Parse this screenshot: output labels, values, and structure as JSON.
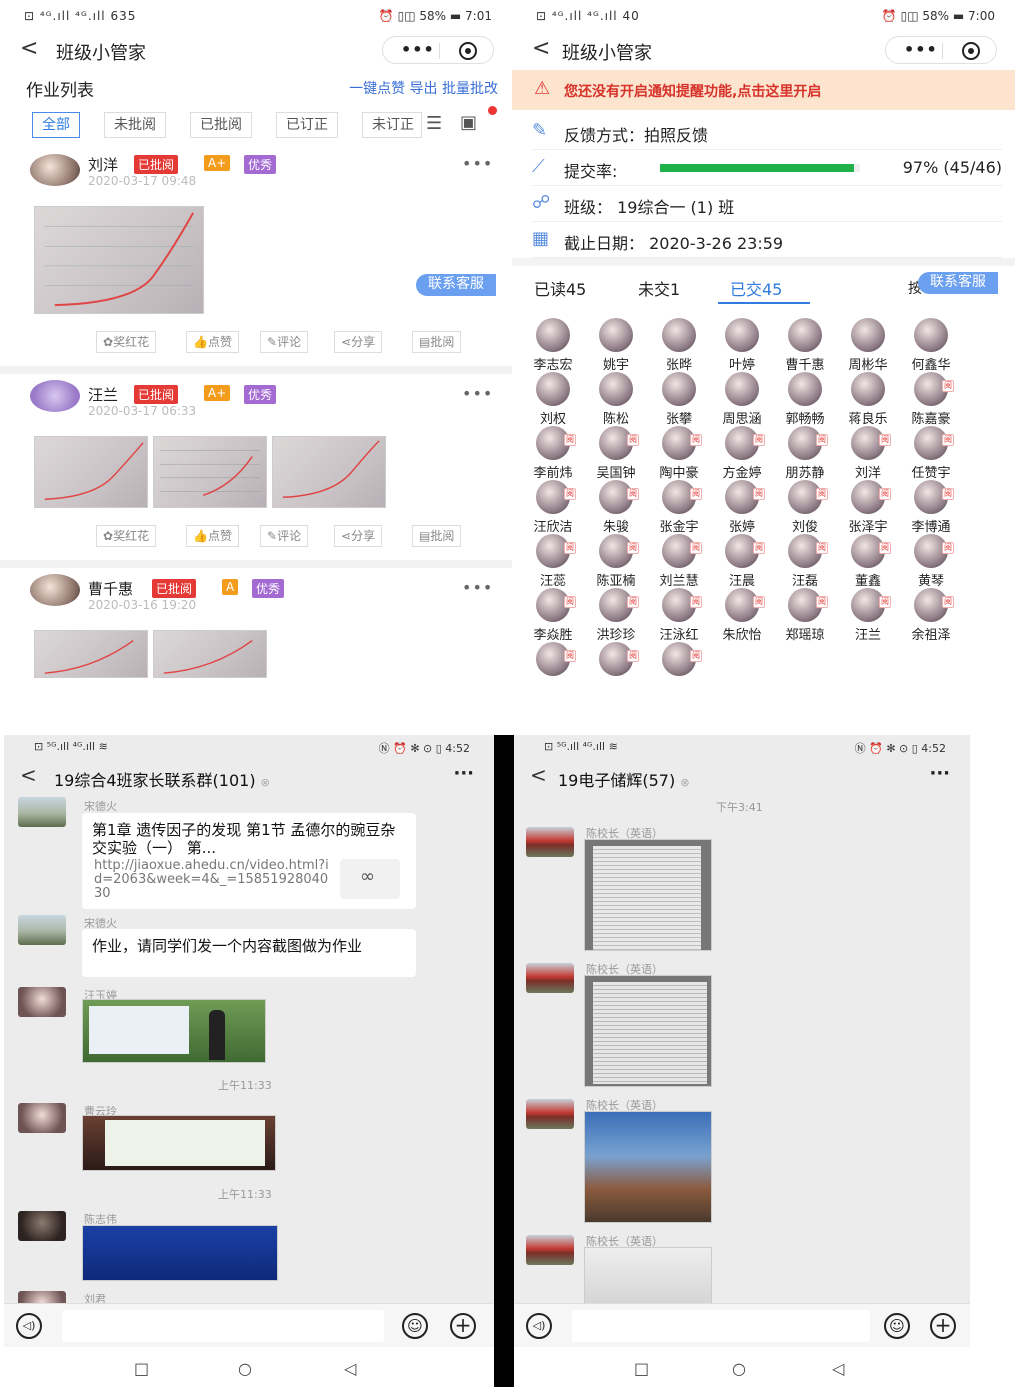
{
  "p1": {
    "status_left": "⊡ ⁴ᴳ.ıll ⁴ᴳ.ıll 635",
    "status_right": "⏰ ▯◫ 58% ▬ 7:01",
    "nav_title": "班级小管家",
    "list_title": "作业列表",
    "actions": "一键点赞  导出  批量批改",
    "filters": [
      "全部",
      "未批阅",
      "已批阅",
      "已订正",
      "未订正"
    ],
    "kefu": "联系客服",
    "action_buttons": [
      "奖红花",
      "点赞",
      "评论",
      "分享",
      "批阅"
    ],
    "posts": [
      {
        "name": "刘洋",
        "tag1": "已批阅",
        "tag2": "A+",
        "tag3": "优秀",
        "date": "2020-03-17 09:48"
      },
      {
        "name": "汪兰",
        "tag1": "已批阅",
        "tag2": "A+",
        "tag3": "优秀",
        "date": "2020-03-17 06:33"
      },
      {
        "name": "曹千惠",
        "tag1": "已批阅",
        "tag2": "A",
        "tag3": "优秀",
        "date": "2020-03-16 19:20"
      }
    ]
  },
  "p2": {
    "status_left": "⊡ ⁴ᴳ.ıll ⁴ᴳ.ıll 40",
    "status_right": "⏰ ▯◫ 58% ▬ 7:00",
    "nav_title": "班级小管家",
    "warning": "您还没有开启通知提醒功能,点击这里开启",
    "feedback": "反馈方式：拍照反馈",
    "rate_label": "提交率:",
    "rate_value": 0.97,
    "rate_text": "97% (45/46)",
    "class_label": "班级：  19综合一  (1)  班",
    "deadline": "截止日期：  2020-3-26 23:59",
    "tabs": [
      "已读45",
      "未交1",
      "已交45"
    ],
    "tab_extra": "按",
    "kefu": "联系客服",
    "read_mark": "阅",
    "students": [
      "李志宏",
      "姚宇",
      "张晔",
      "叶婷",
      "曹千惠",
      "周彬华",
      "何鑫华",
      "刘权",
      "陈松",
      "张攀",
      "周思涵",
      "郭畅畅",
      "蒋良乐",
      "陈嘉豪",
      "李前炜",
      "吴国钟",
      "陶中豪",
      "方金婷",
      "朋苏静",
      "刘洋",
      "任赞宇",
      "汪欣洁",
      "朱骏",
      "张金宇",
      "张婷",
      "刘俊",
      "张泽宇",
      "李博通",
      "汪蕊",
      "陈亚楠",
      "刘兰慧",
      "汪晨",
      "汪磊",
      "董鑫",
      "黄琴",
      "李焱胜",
      "洪珍珍",
      "汪泳红",
      "朱欣怡",
      "郑瑶琼",
      "汪兰",
      "余祖泽",
      "",
      "",
      ""
    ]
  },
  "p3": {
    "status_left": "⊡ ⁵ᴳ.ıll ⁴ᴳ.ıll ≋",
    "status_right": "Ⓝ ⏰ ✻ ⊙ ▯ 4:52",
    "title": "19综合4班家长联系群(101)",
    "mute_icon": "⊗",
    "messages": {
      "m1_sender": "宋德火",
      "m1_text": "第1章 遗传因子的发现 第1节 孟德尔的豌豆杂交实验（一） 第...",
      "m1_link": "http://jiaoxue.ahedu.cn/video.html?id=2063&week=4&_=1585192804030",
      "m2_sender": "宋德火",
      "m2_text": "作业，请同学们发一个内容截图做为作业",
      "m3_sender": "汪玉婷",
      "t1": "上午11:33",
      "m4_sender": "曹云玲",
      "t2": "上午11:33",
      "m5_sender": "陈志伟",
      "m6_sender": "刘君"
    }
  },
  "p4": {
    "status_left": "⊡ ⁵ᴳ.ıll ⁴ᴳ.ıll ≋",
    "status_right": "Ⓝ ⏰ ✻ ⊙ ▯ 4:52",
    "title": "19电子储辉(57)",
    "mute_icon": "⊗",
    "time": "下午3:41",
    "sender": "陈校长（英语）"
  },
  "chat_ui": {
    "voice": "◁)",
    "emoji": "☺",
    "plus": "+",
    "nav": [
      "□",
      "○",
      "◁"
    ]
  },
  "colors": {
    "accent": "#2f7be0",
    "warn": "#d6322a",
    "progress": "#21b14b",
    "tag_red": "#e53935",
    "tag_orange": "#f39b1b",
    "tag_purple": "#a36ad2"
  }
}
